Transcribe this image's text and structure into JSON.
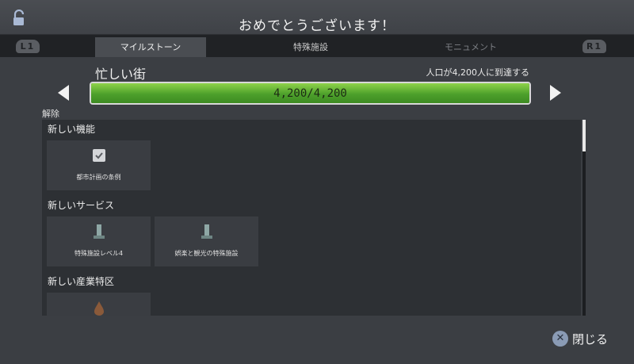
{
  "header": {
    "title": "おめでとうございます！"
  },
  "tabs": {
    "left_shoulder": "L1",
    "right_shoulder": "R1",
    "items": [
      {
        "label": "マイルストーン"
      },
      {
        "label": "特殊施設"
      },
      {
        "label": "モニュメント"
      }
    ]
  },
  "milestone": {
    "name": "忙しい街",
    "requirement": "人口が4,200人に到達する",
    "progress_text": "4,200/4,200",
    "progress_fraction": 1.0
  },
  "unlocks": {
    "label": "解除",
    "sections": [
      {
        "title": "新しい機能",
        "items": [
          {
            "label": "都市計画の条例",
            "icon": "checkbox-icon"
          }
        ]
      },
      {
        "title": "新しいサービス",
        "items": [
          {
            "label": "特殊施設レベル4",
            "icon": "monument-icon"
          },
          {
            "label": "娯楽と観光の特殊施設",
            "icon": "monument-icon"
          }
        ]
      },
      {
        "title": "新しい産業特区",
        "items": [
          {
            "label": "",
            "icon": "oil-drop-icon"
          }
        ]
      }
    ]
  },
  "footer": {
    "close_label": "閉じる",
    "close_button_icon": "cross-button-icon"
  },
  "colors": {
    "progress_green": "#5cb531",
    "panel_bg": "#2d3034",
    "card_bg": "#3a3d42"
  }
}
